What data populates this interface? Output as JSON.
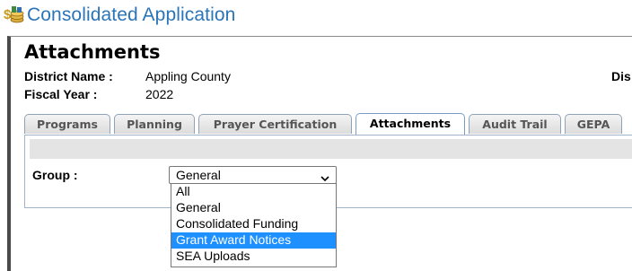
{
  "app": {
    "title": "Consolidated Application",
    "logo_icon": "money-coins-icon"
  },
  "page": {
    "title": "Attachments"
  },
  "info": {
    "district_label": "District Name :",
    "district_value": "Appling County",
    "fiscal_label": "Fiscal Year :",
    "fiscal_value": "2022",
    "right_label_partial": "Dis"
  },
  "tabs": [
    {
      "label": "Programs",
      "active": false
    },
    {
      "label": "Planning",
      "active": false
    },
    {
      "label": "Prayer Certification",
      "active": false
    },
    {
      "label": "Attachments",
      "active": true
    },
    {
      "label": "Audit Trail",
      "active": false
    },
    {
      "label": "GEPA",
      "active": false
    }
  ],
  "group": {
    "label": "Group :",
    "selected_value": "General",
    "options": [
      "All",
      "General",
      "Consolidated Funding",
      "Grant Award Notices",
      "SEA Uploads"
    ],
    "highlighted_option": "Grant Award Notices"
  },
  "colors": {
    "title_blue": "#2a74b8",
    "highlight": "#1e90ff"
  }
}
